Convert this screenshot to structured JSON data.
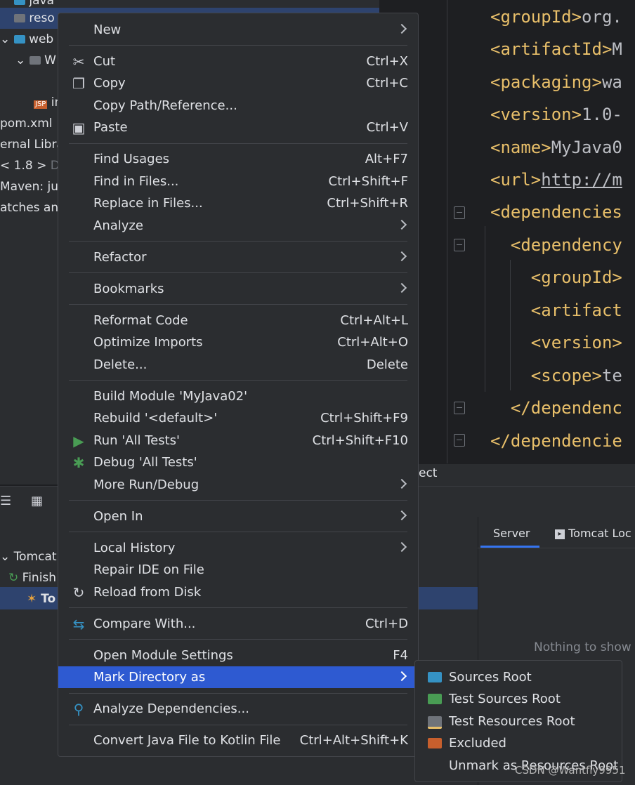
{
  "project_tree": {
    "items": [
      "java",
      "reso",
      "web",
      "W",
      "in",
      "pom.xml",
      "ernal Libra",
      "< 1.8 >",
      "D:",
      "Maven: jur",
      "atches and"
    ]
  },
  "editor": {
    "lines": [
      {
        "tag": "<groupId>",
        "text": "org."
      },
      {
        "tag": "<artifactId>",
        "text": "M"
      },
      {
        "tag": "<packaging>",
        "text": "wa"
      },
      {
        "tag": "<version>",
        "text": "1.0-"
      },
      {
        "tag": "<name>",
        "text": "MyJava0"
      },
      {
        "tag": "<url>",
        "text": "http://m"
      },
      {
        "tag": "<dependencies",
        "text": ""
      },
      {
        "tag": "  <dependency",
        "text": ""
      },
      {
        "tag": "    <groupId>",
        "text": ""
      },
      {
        "tag": "    <artifact",
        "text": ""
      },
      {
        "tag": "    <version>",
        "text": ""
      },
      {
        "tag": "    <scope>",
        "text": "te"
      },
      {
        "tag": "  </dependenc",
        "text": ""
      },
      {
        "tag": "</dependencie",
        "text": ""
      }
    ]
  },
  "strip": {
    "text": "ect"
  },
  "services": {
    "row1": "Tomcat S",
    "row2": "Finish",
    "row3": "To",
    "tabs": [
      "Server",
      "Tomcat Loc"
    ],
    "empty": "Nothing to show"
  },
  "menu": {
    "new": "New",
    "cut": {
      "label": "Cut",
      "shortcut": "Ctrl+X"
    },
    "copy": {
      "label": "Copy",
      "shortcut": "Ctrl+C"
    },
    "copy_path": "Copy Path/Reference...",
    "paste": {
      "label": "Paste",
      "shortcut": "Ctrl+V"
    },
    "find_usages": {
      "label": "Find Usages",
      "shortcut": "Alt+F7"
    },
    "find_in_files": {
      "label": "Find in Files...",
      "shortcut": "Ctrl+Shift+F"
    },
    "replace_in_files": {
      "label": "Replace in Files...",
      "shortcut": "Ctrl+Shift+R"
    },
    "analyze": "Analyze",
    "refactor": "Refactor",
    "bookmarks": "Bookmarks",
    "reformat": {
      "label": "Reformat Code",
      "shortcut": "Ctrl+Alt+L"
    },
    "optimize": {
      "label": "Optimize Imports",
      "shortcut": "Ctrl+Alt+O"
    },
    "delete": {
      "label": "Delete...",
      "shortcut": "Delete"
    },
    "build_module": "Build Module 'MyJava02'",
    "rebuild": {
      "label": "Rebuild '<default>'",
      "shortcut": "Ctrl+Shift+F9"
    },
    "run": {
      "label": "Run 'All Tests'",
      "shortcut": "Ctrl+Shift+F10"
    },
    "debug": "Debug 'All Tests'",
    "more_run": "More Run/Debug",
    "open_in": "Open In",
    "local_history": "Local History",
    "repair": "Repair IDE on File",
    "reload": "Reload from Disk",
    "compare": {
      "label": "Compare With...",
      "shortcut": "Ctrl+D"
    },
    "module_settings": {
      "label": "Open Module Settings",
      "shortcut": "F4"
    },
    "mark_directory": "Mark Directory as",
    "analyze_deps": "Analyze Dependencies...",
    "convert": {
      "label": "Convert Java File to Kotlin File",
      "shortcut": "Ctrl+Alt+Shift+K"
    }
  },
  "submenu": {
    "sources_root": "Sources Root",
    "test_sources_root": "Test Sources Root",
    "test_resources_root": "Test Resources Root",
    "excluded": "Excluded",
    "unmark": "Unmark as Resources Root"
  },
  "colors": {
    "sources": "#3592c4",
    "test_sources": "#499c54",
    "excluded": "#c75f2d",
    "selection": "#2e5ad1"
  },
  "watermark": "CSDN @Wantfly9951"
}
